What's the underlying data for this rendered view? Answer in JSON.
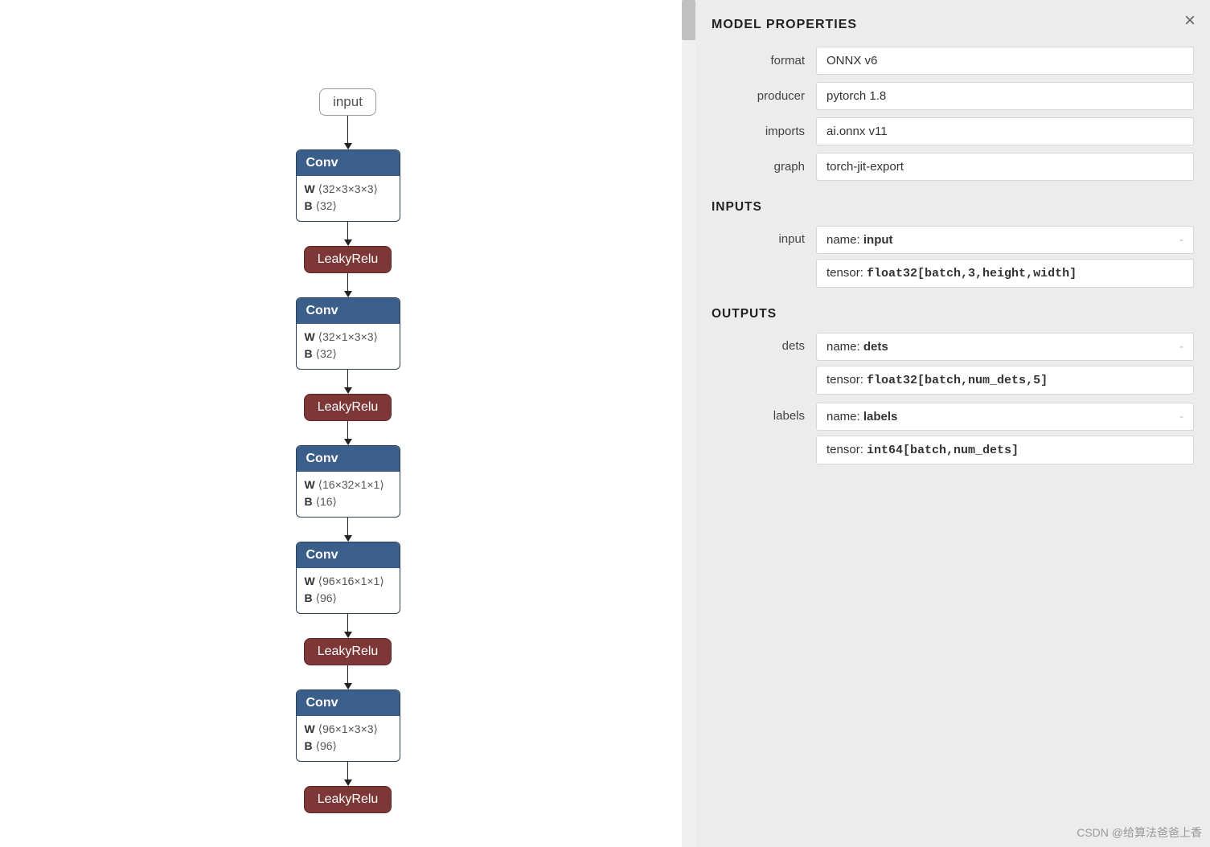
{
  "graph": {
    "input_label": "input",
    "nodes": [
      {
        "type": "conv",
        "title": "Conv",
        "w": "⟨32×3×3×3⟩",
        "b": "⟨32⟩"
      },
      {
        "type": "leaky",
        "title": "LeakyRelu"
      },
      {
        "type": "conv",
        "title": "Conv",
        "w": "⟨32×1×3×3⟩",
        "b": "⟨32⟩"
      },
      {
        "type": "leaky",
        "title": "LeakyRelu"
      },
      {
        "type": "conv",
        "title": "Conv",
        "w": "⟨16×32×1×1⟩",
        "b": "⟨16⟩"
      },
      {
        "type": "conv",
        "title": "Conv",
        "w": "⟨96×16×1×1⟩",
        "b": "⟨96⟩"
      },
      {
        "type": "leaky",
        "title": "LeakyRelu"
      },
      {
        "type": "conv",
        "title": "Conv",
        "w": "⟨96×1×3×3⟩",
        "b": "⟨96⟩"
      },
      {
        "type": "leaky",
        "title": "LeakyRelu"
      }
    ]
  },
  "side": {
    "title": "MODEL PROPERTIES",
    "props": {
      "format": {
        "label": "format",
        "value": "ONNX v6"
      },
      "producer": {
        "label": "producer",
        "value": "pytorch 1.8"
      },
      "imports": {
        "label": "imports",
        "value": "ai.onnx v11"
      },
      "graph": {
        "label": "graph",
        "value": "torch-jit-export"
      }
    },
    "inputs_title": "INPUTS",
    "inputs": [
      {
        "label": "input",
        "name_prefix": "name: ",
        "name": "input",
        "tensor_prefix": "tensor: ",
        "tensor": "float32[batch,3,height,width]"
      }
    ],
    "outputs_title": "OUTPUTS",
    "outputs": [
      {
        "label": "dets",
        "name_prefix": "name: ",
        "name": "dets",
        "tensor_prefix": "tensor: ",
        "tensor": "float32[batch,num_dets,5]"
      },
      {
        "label": "labels",
        "name_prefix": "name: ",
        "name": "labels",
        "tensor_prefix": "tensor: ",
        "tensor": "int64[batch,num_dets]"
      }
    ]
  },
  "watermark": "CSDN @给算法爸爸上香",
  "labels": {
    "W": "W",
    "B": "B"
  }
}
